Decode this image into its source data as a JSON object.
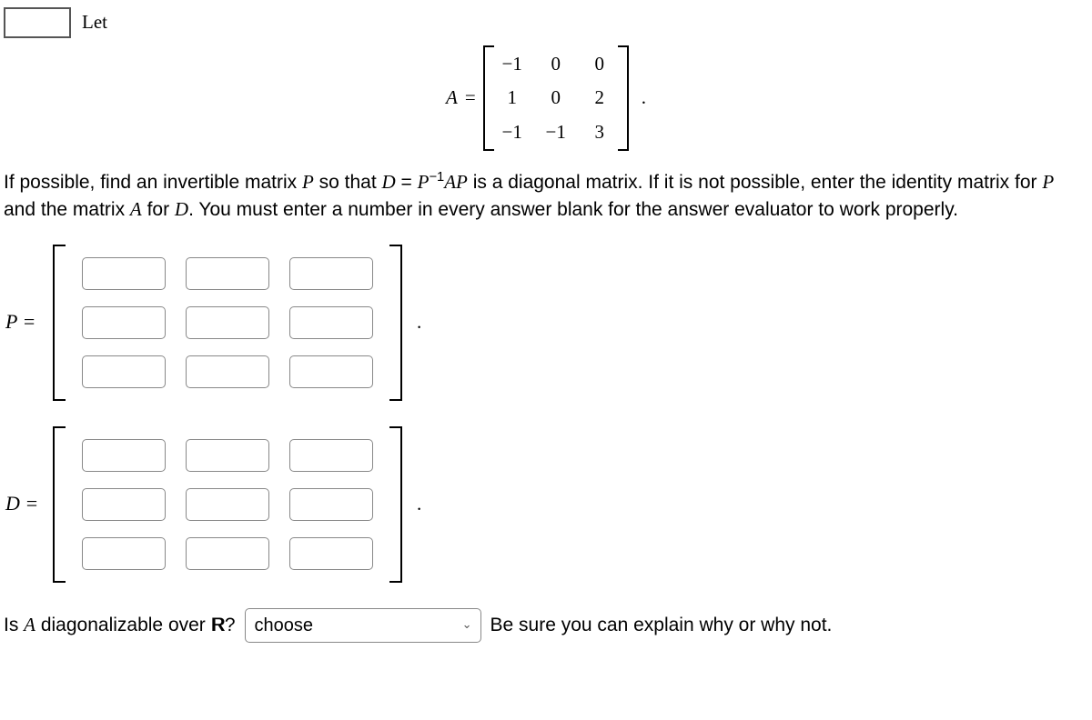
{
  "header": {
    "let": "Let"
  },
  "matrixA": {
    "label": "A",
    "eq": "=",
    "rows": [
      [
        "−1",
        "0",
        "0"
      ],
      [
        "1",
        "0",
        "2"
      ],
      [
        "−1",
        "−1",
        "3"
      ]
    ],
    "period": "."
  },
  "instructions": {
    "part1": "If possible, find an invertible matrix ",
    "P": "P",
    "part2": " so that ",
    "D": "D",
    "eq": " = ",
    "Pinv": "P",
    "inv_exp": "−1",
    "AP_A": "A",
    "AP_P": "P",
    "part3": " is a diagonal matrix. If it is not possible, enter the identity matrix for ",
    "P2": "P",
    "part4": " and the matrix ",
    "A2": "A",
    "part5": " for ",
    "D2": "D",
    "part6": ". You must enter a number in every answer blank for the answer evaluator to work properly."
  },
  "answers": {
    "P_label": "P =",
    "D_label": "D =",
    "period": "."
  },
  "question": {
    "part1": "Is ",
    "A": "A",
    "part2": " diagonalizable over ",
    "R": "R",
    "qmark": "?",
    "select_placeholder": "choose",
    "part3": "Be sure you can explain why or why not."
  }
}
